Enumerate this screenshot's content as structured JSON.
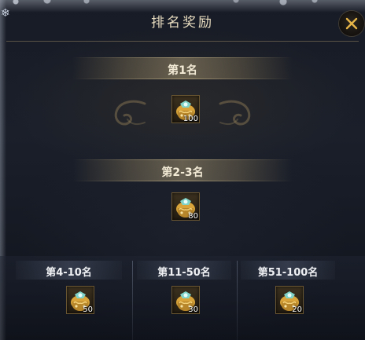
{
  "window": {
    "title": "排名奖励",
    "close_icon": "close-x-icon",
    "accent_color": "#e7b648"
  },
  "tiers": [
    {
      "label": "第1名",
      "reward": {
        "icon": "gold-chest-icon",
        "count": "100"
      }
    },
    {
      "label": "第2-3名",
      "reward": {
        "icon": "gold-chest-icon",
        "count": "80"
      }
    },
    {
      "label": "第4-10名",
      "reward": {
        "icon": "gold-chest-icon",
        "count": "50"
      }
    },
    {
      "label": "第11-50名",
      "reward": {
        "icon": "gold-chest-icon",
        "count": "30"
      }
    },
    {
      "label": "第51-100名",
      "reward": {
        "icon": "gold-chest-icon",
        "count": "20"
      }
    }
  ]
}
